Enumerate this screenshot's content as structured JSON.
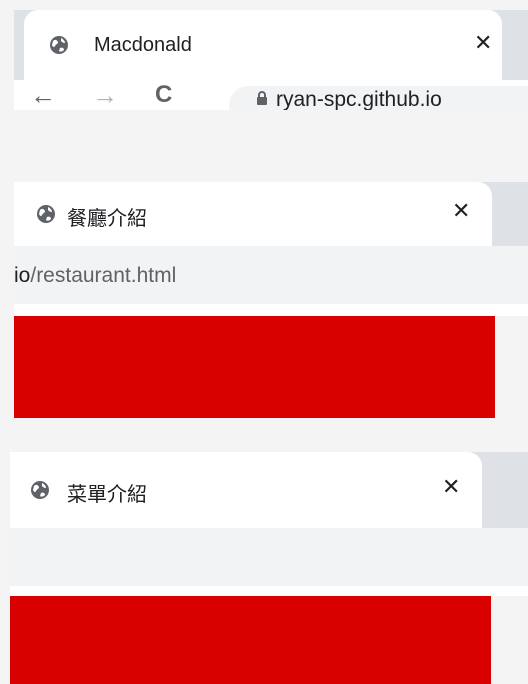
{
  "colors": {
    "accent_red": "#d90000",
    "tab_strip": "#dee1e6",
    "address_bar": "#f1f3f4"
  },
  "icons": {
    "favicon": "globe-icon",
    "close": "close-icon",
    "back": "arrow-left-icon",
    "forward": "arrow-right-icon",
    "reload": "reload-icon",
    "lock": "lock-icon"
  },
  "panel1": {
    "tab_title": "Macdonald",
    "close_glyph": "✕",
    "back_glyph": "←",
    "forward_glyph": "→",
    "reload_glyph": "C",
    "url": "ryan-spc.github.io"
  },
  "panel2": {
    "tab_title": "餐廳介紹",
    "close_glyph": "✕",
    "url_host": "io",
    "url_path": "/restaurant.html"
  },
  "panel3": {
    "tab_title": "菜單介紹",
    "close_glyph": "✕"
  }
}
